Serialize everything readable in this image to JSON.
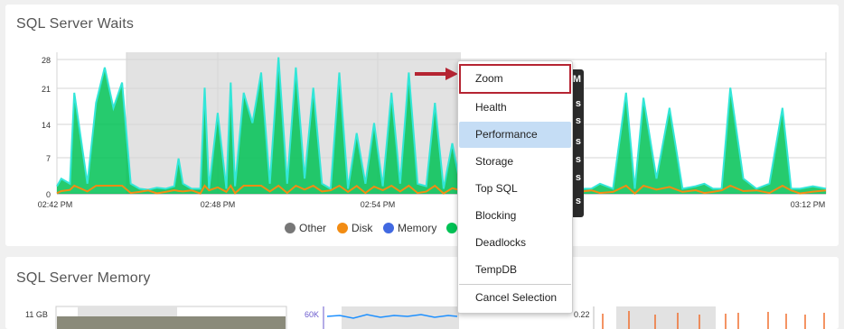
{
  "waits": {
    "title": "SQL Server Waits",
    "chart_data": {
      "type": "area",
      "title": "SQL Server Waits",
      "y_ticks": [
        "0",
        "7",
        "14",
        "21",
        "28"
      ],
      "ylim": [
        0,
        28
      ],
      "x_ticks": [
        "02:42 PM",
        "02:48 PM",
        "02:54 PM",
        "03:12 PM"
      ],
      "series_order": [
        "Other",
        "Disk",
        "Memory",
        "CPU"
      ],
      "series_colors": {
        "Other": "#777777",
        "Disk": "#f28c13",
        "Memory": "#4169e1",
        "CPU": "#00c255"
      },
      "overlay_color": "#33e6d8",
      "selection_shading": true,
      "grid": true,
      "legend_position": "bottom",
      "legend": [
        {
          "name": "Other",
          "color": "#777777"
        },
        {
          "name": "Disk",
          "color": "#f28c13"
        },
        {
          "name": "Memory",
          "color": "#4169e1"
        }
      ],
      "series": [
        {
          "name": "CPU",
          "x": [
            1,
            2,
            4,
            5,
            8,
            10,
            12,
            14,
            16,
            18,
            20,
            22,
            24,
            26,
            28,
            29,
            30,
            32,
            34,
            35,
            36,
            38,
            40,
            41,
            42,
            44,
            46,
            48,
            50,
            52,
            54,
            56,
            58,
            60,
            62,
            64,
            66,
            68,
            70,
            72,
            74,
            76,
            78,
            80,
            82,
            84,
            86,
            88,
            90,
            92,
            94,
            96,
            98,
            100,
            102,
            104,
            106,
            110,
            112,
            114,
            118,
            121,
            124,
            126,
            129,
            132,
            134,
            136,
            139,
            142,
            145,
            148,
            150,
            152,
            154,
            156,
            159,
            162,
            165,
            168,
            170,
            172,
            175,
            178
          ],
          "values": [
            1.5,
            3,
            2,
            20,
            2,
            18,
            25,
            17,
            22,
            2,
            1,
            0.8,
            1.2,
            1,
            1.5,
            7,
            2,
            1,
            1,
            21,
            1,
            16,
            1,
            22,
            1.5,
            20,
            14,
            24,
            2,
            27,
            2,
            25,
            3,
            21,
            2,
            1,
            24,
            1,
            12,
            2,
            14,
            1.5,
            20,
            2,
            24,
            2,
            1.5,
            18,
            1,
            10,
            1,
            16,
            2,
            1,
            1.5,
            13,
            22,
            1,
            1,
            1,
            1,
            1,
            1,
            2,
            1,
            20,
            1,
            19,
            3,
            17,
            1,
            1.5,
            2,
            1,
            1,
            21,
            3,
            1,
            2,
            17,
            1,
            1,
            1.5,
            1
          ]
        }
      ]
    }
  },
  "memory": {
    "title": "SQL Server Memory",
    "y_label_left": "11 GB",
    "y_label_middle": "60K",
    "y_label_right": "0.22"
  },
  "tooltip": {
    "lines": [
      "M",
      "s",
      "s",
      "s",
      "s",
      "s",
      "s"
    ]
  },
  "context_menu": {
    "items": [
      {
        "label": "Zoom",
        "state": "annotated"
      },
      {
        "label": "Health",
        "state": "normal"
      },
      {
        "label": "Performance",
        "state": "hover"
      },
      {
        "label": "Storage",
        "state": "normal"
      },
      {
        "label": "Top SQL",
        "state": "normal"
      },
      {
        "label": "Blocking",
        "state": "normal"
      },
      {
        "label": "Deadlocks",
        "state": "normal"
      },
      {
        "label": "TempDB",
        "state": "normal"
      },
      {
        "label": "Cancel Selection",
        "state": "normal"
      }
    ],
    "highlight_color": "#c5ddf5",
    "annotation_color": "#b52432"
  }
}
